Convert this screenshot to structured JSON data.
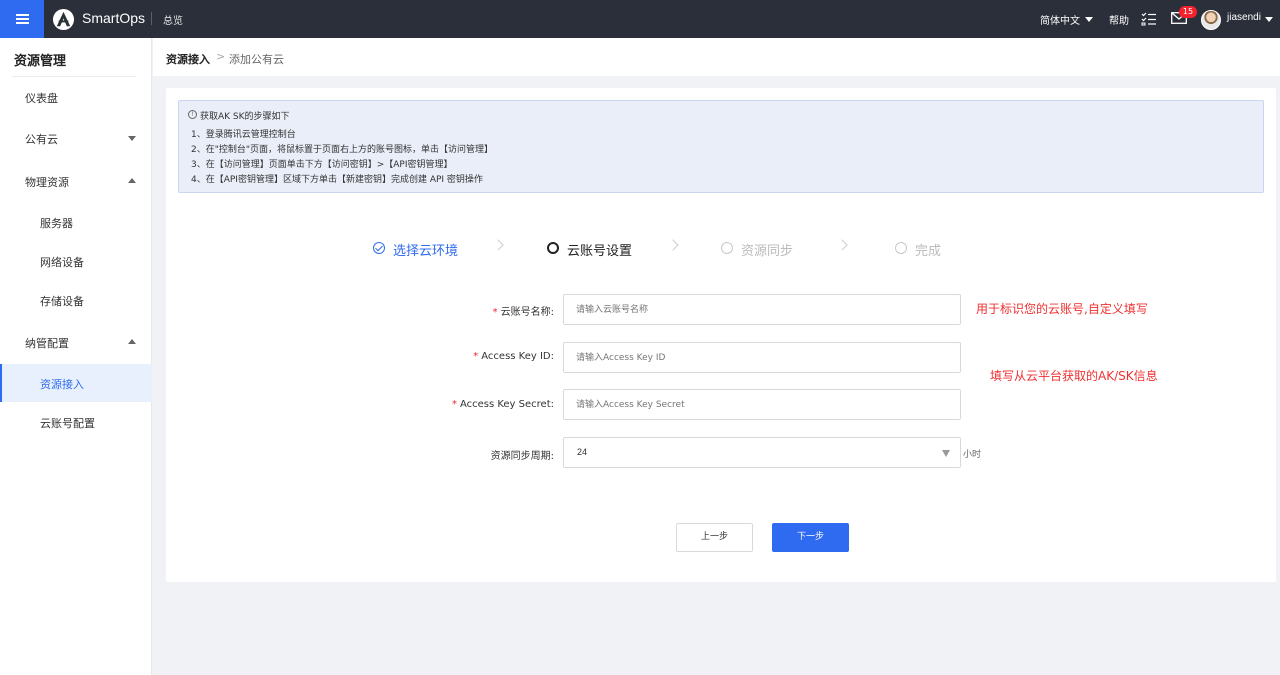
{
  "topbar": {
    "brand": "SmartOps",
    "nav_overview": "总览",
    "language": "简体中文",
    "help": "帮助",
    "mail_count": "15",
    "username": "jiasendi"
  },
  "sidebar": {
    "title": "资源管理",
    "items": [
      {
        "label": "仪表盘"
      },
      {
        "label": "公有云"
      },
      {
        "label": "物理资源"
      },
      {
        "label": "服务器"
      },
      {
        "label": "网络设备"
      },
      {
        "label": "存储设备"
      },
      {
        "label": "纳管配置"
      },
      {
        "label": "资源接入"
      },
      {
        "label": "云账号配置"
      }
    ]
  },
  "breadcrumb": {
    "parent": "资源接入",
    "separator": ">",
    "current": "添加公有云"
  },
  "notice": {
    "title": "获取AK SK的步骤如下",
    "lines": [
      "1、登录腾讯云管理控制台",
      "2、在\"控制台\"页面，将鼠标置于页面右上方的账号图标，单击【访问管理】",
      "3、在【访问管理】页面单击下方【访问密钥】>【API密钥管理】",
      "4、在【API密钥管理】区域下方单击【新建密钥】完成创建 API 密钥操作"
    ]
  },
  "steps": [
    {
      "label": "选择云环境",
      "status": "done"
    },
    {
      "label": "云账号设置",
      "status": "current"
    },
    {
      "label": "资源同步",
      "status": "todo"
    },
    {
      "label": "完成",
      "status": "todo"
    }
  ],
  "form": {
    "required_mark": "*",
    "account_name": {
      "label": "云账号名称:",
      "placeholder": "请输入云账号名称"
    },
    "access_key_id": {
      "label": "Access Key ID:",
      "placeholder": "请输入Access Key ID"
    },
    "access_key_secret": {
      "label": "Access Key Secret:",
      "placeholder": "请输入Access Key Secret"
    },
    "sync_period": {
      "label": "资源同步周期:",
      "value": "24",
      "unit": "小时"
    }
  },
  "annotations": {
    "account_name_hint": "用于标识您的云账号,自定义填写",
    "aksk_hint": "填写从云平台获取的AK/SK信息"
  },
  "buttons": {
    "prev": "上一步",
    "next": "下一步"
  },
  "colors": {
    "accent": "#2f6bf0",
    "topbar": "#2b2f3a",
    "annotation": "#f03030",
    "badge": "#f5222d"
  }
}
